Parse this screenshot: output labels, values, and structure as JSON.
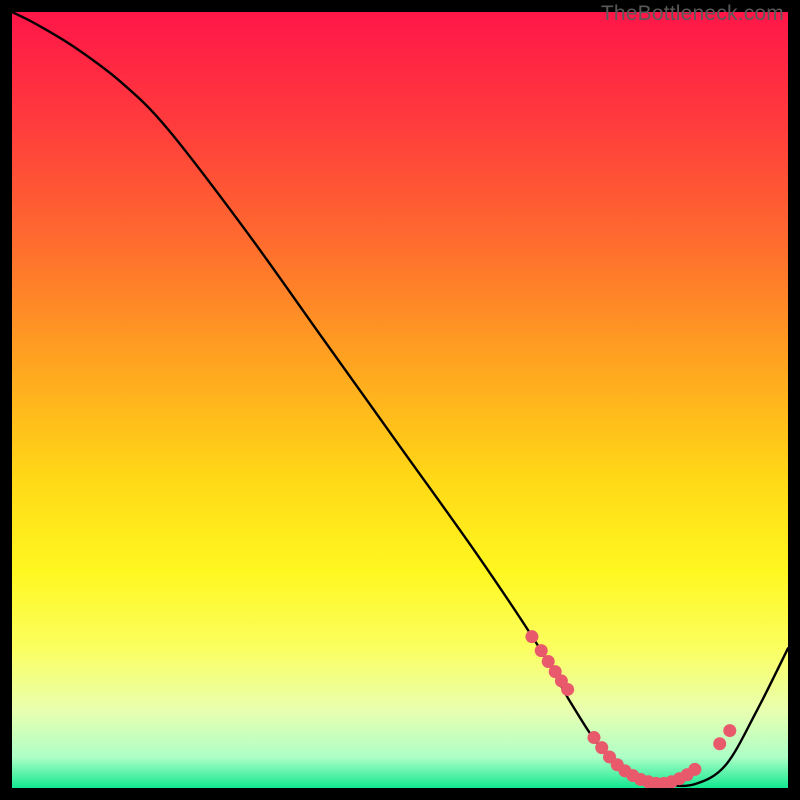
{
  "watermark": "TheBottleneck.com",
  "chart_data": {
    "type": "line",
    "title": "",
    "xlabel": "",
    "ylabel": "",
    "xlim": [
      0,
      100
    ],
    "ylim": [
      0,
      100
    ],
    "background_gradient_stops": [
      {
        "offset": 0.0,
        "color": "#ff1649"
      },
      {
        "offset": 0.15,
        "color": "#ff3d3c"
      },
      {
        "offset": 0.3,
        "color": "#ff6d2e"
      },
      {
        "offset": 0.45,
        "color": "#ffa320"
      },
      {
        "offset": 0.6,
        "color": "#ffd816"
      },
      {
        "offset": 0.72,
        "color": "#fff720"
      },
      {
        "offset": 0.82,
        "color": "#fbff60"
      },
      {
        "offset": 0.9,
        "color": "#e9ffb0"
      },
      {
        "offset": 0.96,
        "color": "#aeffc7"
      },
      {
        "offset": 1.0,
        "color": "#12e88f"
      }
    ],
    "series": [
      {
        "name": "curve",
        "x": [
          0,
          3,
          8,
          14,
          20,
          30,
          40,
          50,
          60,
          68,
          72,
          76,
          80,
          84,
          88,
          92,
          96,
          100
        ],
        "y": [
          100,
          98.5,
          95.5,
          91,
          85,
          72,
          58,
          44,
          30,
          18,
          11,
          5,
          1.5,
          0.5,
          0.5,
          3,
          10,
          18
        ]
      }
    ],
    "marker_points": {
      "x": [
        67,
        68.2,
        69.1,
        70.0,
        70.8,
        71.6,
        75,
        76,
        77,
        78,
        79,
        80,
        81,
        82,
        83,
        84,
        85,
        86,
        87,
        88,
        91.2,
        92.5
      ],
      "y": [
        19.5,
        17.7,
        16.3,
        15.0,
        13.8,
        12.7,
        6.5,
        5.2,
        4.0,
        3.0,
        2.2,
        1.6,
        1.1,
        0.8,
        0.6,
        0.6,
        0.8,
        1.2,
        1.7,
        2.4,
        5.7,
        7.4
      ]
    }
  }
}
